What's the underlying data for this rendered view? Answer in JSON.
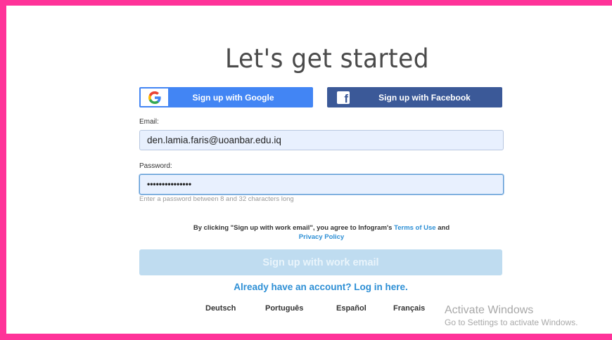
{
  "page": {
    "title": "Let's get started"
  },
  "social": {
    "google_label": "Sign up with Google",
    "facebook_label": "Sign up with Facebook",
    "google_icon": "google-g-icon",
    "facebook_icon": "facebook-f-icon"
  },
  "form": {
    "email_label": "Email:",
    "email_value": "den.lamia.faris@uoanbar.edu.iq",
    "password_label": "Password:",
    "password_value": "•••••••••••••••",
    "password_hint": "Enter a password between 8 and 32 characters long"
  },
  "terms": {
    "prefix": "By clicking \"Sign up with work email\", you agree to Infogram's ",
    "terms_link": "Terms of Use",
    "and": " and",
    "privacy_link": "Privacy Policy"
  },
  "actions": {
    "submit_label": "Sign up with work email",
    "login_link": "Already have an account? Log in here."
  },
  "languages": [
    "Deutsch",
    "Português",
    "Español",
    "Français"
  ],
  "watermark": {
    "line1": "Activate Windows",
    "line2": "Go to Settings to activate Windows."
  },
  "colors": {
    "frame": "#ff3399",
    "google": "#4285f4",
    "facebook": "#3b5998",
    "link": "#2d8fd5",
    "submit_disabled": "#bfdcf0"
  }
}
